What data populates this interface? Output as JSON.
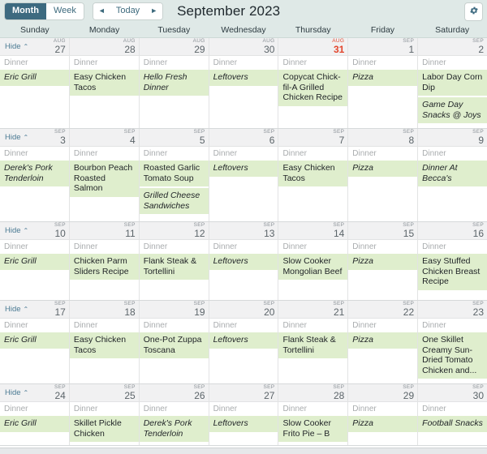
{
  "toolbar": {
    "view_month": "Month",
    "view_week": "Week",
    "prev_label": "◄",
    "today_label": "Today",
    "next_label": "►",
    "title": "September 2023",
    "settings_icon": "gear-icon",
    "active_view": "Month",
    "accent_color": "#3d6a80",
    "header_bg": "#dfe9e7",
    "chip_color": "#dfeecd",
    "today_color": "#e2452c"
  },
  "weekday_headers": [
    "Sunday",
    "Monday",
    "Tuesday",
    "Wednesday",
    "Thursday",
    "Friday",
    "Saturday"
  ],
  "hide_label": "Hide",
  "slot_label": "Dinner",
  "weeks": [
    {
      "hide": "Hide",
      "days": [
        {
          "month": "AUG",
          "day": "27",
          "today": false,
          "slot": "Dinner",
          "events": [
            {
              "text": "Eric Grill",
              "italic": true
            }
          ]
        },
        {
          "month": "AUG",
          "day": "28",
          "today": false,
          "slot": "Dinner",
          "events": [
            {
              "text": "Easy Chicken Tacos",
              "italic": false
            }
          ]
        },
        {
          "month": "AUG",
          "day": "29",
          "today": false,
          "slot": "Dinner",
          "events": [
            {
              "text": "Hello Fresh Dinner",
              "italic": true
            }
          ]
        },
        {
          "month": "AUG",
          "day": "30",
          "today": false,
          "slot": "Dinner",
          "events": [
            {
              "text": "Leftovers",
              "italic": true
            }
          ]
        },
        {
          "month": "AUG",
          "day": "31",
          "today": true,
          "slot": "Dinner",
          "events": [
            {
              "text": "Copycat Chick-fil-A Grilled Chicken Recipe",
              "italic": false
            }
          ]
        },
        {
          "month": "SEP",
          "day": "1",
          "today": false,
          "slot": "Dinner",
          "events": [
            {
              "text": "Pizza",
              "italic": true
            }
          ]
        },
        {
          "month": "SEP",
          "day": "2",
          "today": false,
          "slot": "Dinner",
          "events": [
            {
              "text": "Labor Day Corn Dip",
              "italic": false
            },
            {
              "text": "Game Day Snacks @ Joys",
              "italic": true
            }
          ]
        }
      ]
    },
    {
      "hide": "Hide",
      "days": [
        {
          "month": "SEP",
          "day": "3",
          "today": false,
          "slot": "Dinner",
          "events": [
            {
              "text": "Derek's Pork Tenderloin",
              "italic": true
            }
          ]
        },
        {
          "month": "SEP",
          "day": "4",
          "today": false,
          "slot": "Dinner",
          "events": [
            {
              "text": "Bourbon Peach Roasted Salmon",
              "italic": false
            }
          ]
        },
        {
          "month": "SEP",
          "day": "5",
          "today": false,
          "slot": "Dinner",
          "events": [
            {
              "text": "Roasted Garlic Tomato Soup",
              "italic": false
            },
            {
              "text": "Grilled Cheese Sandwiches",
              "italic": true
            }
          ]
        },
        {
          "month": "SEP",
          "day": "6",
          "today": false,
          "slot": "Dinner",
          "events": [
            {
              "text": "Leftovers",
              "italic": true
            }
          ]
        },
        {
          "month": "SEP",
          "day": "7",
          "today": false,
          "slot": "Dinner",
          "events": [
            {
              "text": "Easy Chicken Tacos",
              "italic": false
            }
          ]
        },
        {
          "month": "SEP",
          "day": "8",
          "today": false,
          "slot": "Dinner",
          "events": [
            {
              "text": "Pizza",
              "italic": true
            }
          ]
        },
        {
          "month": "SEP",
          "day": "9",
          "today": false,
          "slot": "Dinner",
          "events": [
            {
              "text": "Dinner At Becca's",
              "italic": true
            }
          ]
        }
      ]
    },
    {
      "hide": "Hide",
      "days": [
        {
          "month": "SEP",
          "day": "10",
          "today": false,
          "slot": "Dinner",
          "events": [
            {
              "text": "Eric Grill",
              "italic": true
            }
          ]
        },
        {
          "month": "SEP",
          "day": "11",
          "today": false,
          "slot": "Dinner",
          "events": [
            {
              "text": "Chicken Parm Sliders Recipe",
              "italic": false
            }
          ]
        },
        {
          "month": "SEP",
          "day": "12",
          "today": false,
          "slot": "Dinner",
          "events": [
            {
              "text": "Flank Steak & Tortellini",
              "italic": false
            }
          ]
        },
        {
          "month": "SEP",
          "day": "13",
          "today": false,
          "slot": "Dinner",
          "events": [
            {
              "text": "Leftovers",
              "italic": true
            }
          ]
        },
        {
          "month": "SEP",
          "day": "14",
          "today": false,
          "slot": "Dinner",
          "events": [
            {
              "text": "Slow Cooker Mongolian Beef",
              "italic": false
            }
          ]
        },
        {
          "month": "SEP",
          "day": "15",
          "today": false,
          "slot": "Dinner",
          "events": [
            {
              "text": "Pizza",
              "italic": true
            }
          ]
        },
        {
          "month": "SEP",
          "day": "16",
          "today": false,
          "slot": "Dinner",
          "events": [
            {
              "text": "Easy Stuffed Chicken Breast Recipe",
              "italic": false
            }
          ]
        }
      ]
    },
    {
      "hide": "Hide",
      "days": [
        {
          "month": "SEP",
          "day": "17",
          "today": false,
          "slot": "Dinner",
          "events": [
            {
              "text": "Eric Grill",
              "italic": true
            }
          ]
        },
        {
          "month": "SEP",
          "day": "18",
          "today": false,
          "slot": "Dinner",
          "events": [
            {
              "text": "Easy Chicken Tacos",
              "italic": false
            }
          ]
        },
        {
          "month": "SEP",
          "day": "19",
          "today": false,
          "slot": "Dinner",
          "events": [
            {
              "text": "One-Pot Zuppa Toscana",
              "italic": false
            }
          ]
        },
        {
          "month": "SEP",
          "day": "20",
          "today": false,
          "slot": "Dinner",
          "events": [
            {
              "text": "Leftovers",
              "italic": true
            }
          ]
        },
        {
          "month": "SEP",
          "day": "21",
          "today": false,
          "slot": "Dinner",
          "events": [
            {
              "text": "Flank Steak & Tortellini",
              "italic": false
            }
          ]
        },
        {
          "month": "SEP",
          "day": "22",
          "today": false,
          "slot": "Dinner",
          "events": [
            {
              "text": "Pizza",
              "italic": true
            }
          ]
        },
        {
          "month": "SEP",
          "day": "23",
          "today": false,
          "slot": "Dinner",
          "events": [
            {
              "text": "One Skillet Creamy Sun-Dried Tomato Chicken and...",
              "italic": false
            }
          ]
        }
      ]
    },
    {
      "hide": "Hide",
      "days": [
        {
          "month": "SEP",
          "day": "24",
          "today": false,
          "slot": "Dinner",
          "events": [
            {
              "text": "Eric Grill",
              "italic": true
            }
          ]
        },
        {
          "month": "SEP",
          "day": "25",
          "today": false,
          "slot": "Dinner",
          "events": [
            {
              "text": "Skillet Pickle Chicken",
              "italic": false
            }
          ]
        },
        {
          "month": "SEP",
          "day": "26",
          "today": false,
          "slot": "Dinner",
          "events": [
            {
              "text": "Derek's Pork Tenderloin",
              "italic": true
            }
          ]
        },
        {
          "month": "SEP",
          "day": "27",
          "today": false,
          "slot": "Dinner",
          "events": [
            {
              "text": "Leftovers",
              "italic": true
            }
          ]
        },
        {
          "month": "SEP",
          "day": "28",
          "today": false,
          "slot": "Dinner",
          "events": [
            {
              "text": "Slow Cooker Frito Pie – B",
              "italic": false
            }
          ]
        },
        {
          "month": "SEP",
          "day": "29",
          "today": false,
          "slot": "Dinner",
          "events": [
            {
              "text": "Pizza",
              "italic": true
            }
          ]
        },
        {
          "month": "SEP",
          "day": "30",
          "today": false,
          "slot": "Dinner",
          "events": [
            {
              "text": "Football Snacks",
              "italic": true
            }
          ]
        }
      ]
    }
  ]
}
